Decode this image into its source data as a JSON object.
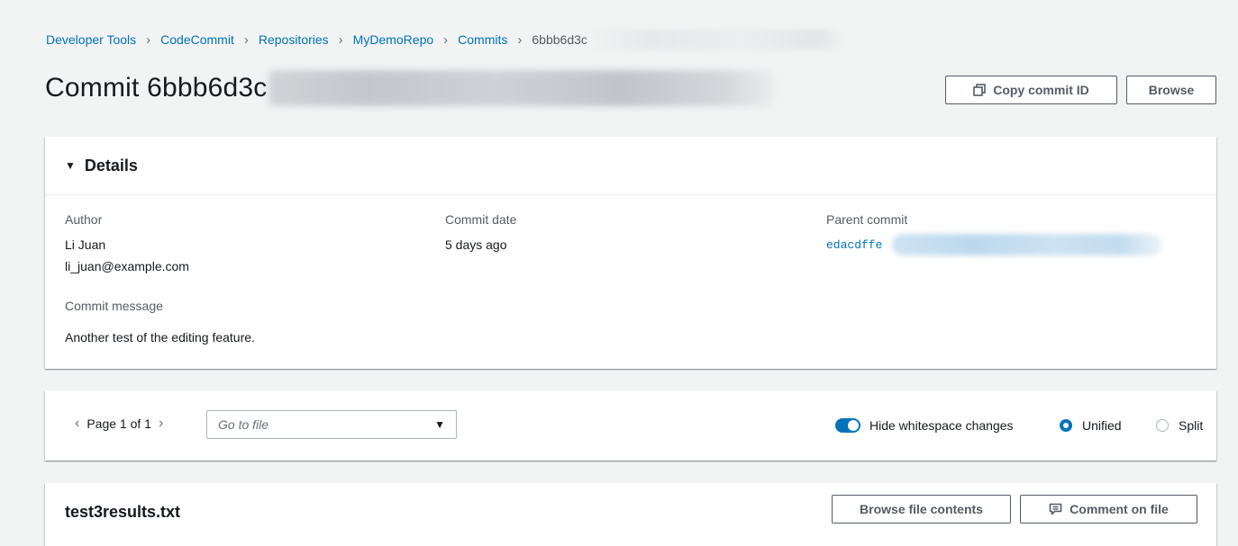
{
  "breadcrumb": {
    "items": [
      "Developer Tools",
      "CodeCommit",
      "Repositories",
      "MyDemoRepo",
      "Commits"
    ],
    "current": "6bbb6d3c"
  },
  "header": {
    "title": "Commit 6bbb6d3c",
    "copy_label": "Copy commit ID",
    "browse_label": "Browse"
  },
  "details": {
    "heading": "Details",
    "author_label": "Author",
    "author_name": "Li Juan",
    "author_email": "li_juan@example.com",
    "commit_date_label": "Commit date",
    "commit_date": "5 days ago",
    "parent_label": "Parent commit",
    "parent_value": "edacdffe",
    "message_label": "Commit message",
    "message": "Another test of the editing feature."
  },
  "toolbar": {
    "page_text": "Page 1 of 1",
    "goto_placeholder": "Go to file",
    "hide_whitespace_label": "Hide whitespace changes",
    "hide_whitespace_on": true,
    "unified_label": "Unified",
    "split_label": "Split",
    "selected_view": "Unified"
  },
  "file": {
    "name": "test3results.txt",
    "browse_label": "Browse file contents",
    "comment_label": "Comment on file"
  },
  "colors": {
    "link": "#0073bb",
    "background": "#f2f3f3",
    "border": "#545b64"
  },
  "icons": [
    "copy-icon",
    "caret-down-icon",
    "chevron-left-icon",
    "chevron-right-icon",
    "dropdown-icon",
    "comment-icon"
  ]
}
